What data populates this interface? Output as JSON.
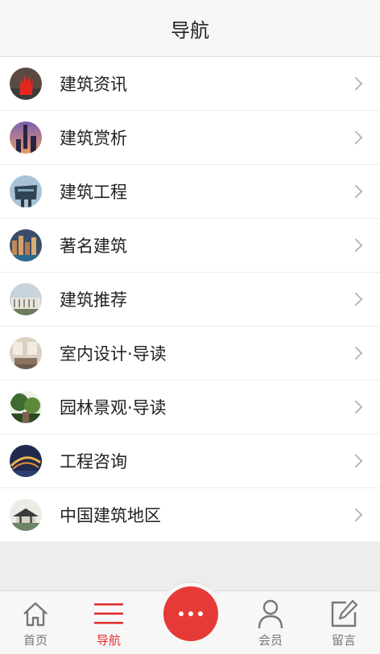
{
  "header": {
    "title": "导航"
  },
  "menu": {
    "items": [
      {
        "label": "建筑资讯",
        "icon": "red-sculpture-thumbnail"
      },
      {
        "label": "建筑赏析",
        "icon": "tower-sunset-thumbnail"
      },
      {
        "label": "建筑工程",
        "icon": "bridge-building-thumbnail"
      },
      {
        "label": "著名建筑",
        "icon": "city-night-thumbnail"
      },
      {
        "label": "建筑推荐",
        "icon": "classical-facade-thumbnail"
      },
      {
        "label": "室内设计·导读",
        "icon": "interior-room-thumbnail"
      },
      {
        "label": "园林景观·导读",
        "icon": "garden-thumbnail"
      },
      {
        "label": "工程咨询",
        "icon": "lit-bridge-thumbnail"
      },
      {
        "label": "中国建筑地区",
        "icon": "chinese-pavilion-thumbnail"
      }
    ]
  },
  "tabbar": {
    "tabs": [
      {
        "label": "首页",
        "icon": "home-icon"
      },
      {
        "label": "导航",
        "icon": "menu-icon",
        "active": true
      },
      {
        "label": "",
        "icon": "more-icon"
      },
      {
        "label": "会员",
        "icon": "user-icon"
      },
      {
        "label": "留言",
        "icon": "edit-icon"
      }
    ]
  },
  "colors": {
    "accent": "#e63a36",
    "active_text": "#e02d2d",
    "header_bg": "#f7f7f7",
    "page_bg": "#ededed"
  }
}
